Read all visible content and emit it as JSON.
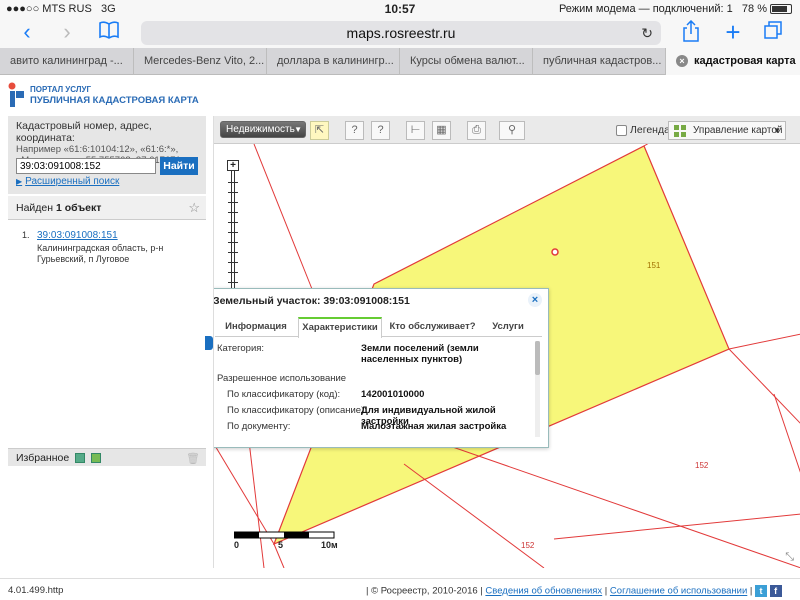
{
  "status_bar": {
    "carrier": "MTS RUS",
    "network": "3G",
    "time": "10:57",
    "hotspot": "Режим модема — подключений: 1",
    "battery": "78 %"
  },
  "browser": {
    "url": "maps.rosreestr.ru",
    "tabs": [
      {
        "label": "авито калининград -..."
      },
      {
        "label": "Mercedes-Benz Vito, 2..."
      },
      {
        "label": "доллара в калинингр..."
      },
      {
        "label": "Курсы обмена валют..."
      },
      {
        "label": "публичная кадастров..."
      },
      {
        "label": "кадастровая карта"
      }
    ]
  },
  "portal": {
    "brand_small": "ПОРТАЛ УСЛУГ",
    "brand_title": "ПУБЛИЧНАЯ КАДАСТРОВАЯ КАРТА"
  },
  "search": {
    "label": "Кадастровый номер, адрес, координата:",
    "hint_line1": "Например «61:6:10104:12», «61:6:*»,",
    "hint_line2": "«Москва» или «55.755768, 37.617671»",
    "value": "39:03:091008:152",
    "button": "Найти",
    "advanced": "Расширенный поиск"
  },
  "results": {
    "found_prefix": "Найден",
    "found_count": "1 объект",
    "items": [
      {
        "num": "1.",
        "cadastral": "39:03:091008:151",
        "address": "Калининградская область, р-н Гурьевский, п Луговое"
      }
    ]
  },
  "favorites": {
    "label": "Избранное"
  },
  "map_toolbar": {
    "layer_dropdown": "Недвижимость",
    "legend_label": "Легенда",
    "map_control": "Управление картой"
  },
  "popup": {
    "title": "Земельный участок: 39:03:091008:151",
    "tabs": [
      "Информация",
      "Характеристики",
      "Кто обслуживает?",
      "Услуги"
    ],
    "rows": {
      "category_label": "Категория:",
      "category_value": "Земли поселений (земли населенных пунктов)",
      "allowed_use": "Разрешенное использование",
      "code_label": "По классификатору (код):",
      "code_value": "142001010000",
      "desc_label": "По классификатору (описание):",
      "desc_value": "Для индивидуальной жилой застройки",
      "doc_label": "По документу:",
      "doc_value": "Малоэтажная жилая застройка"
    }
  },
  "map": {
    "parcel_label_151": "151",
    "parcel_label_152a": "152",
    "parcel_label_152b": "152",
    "scale_0": "0",
    "scale_5": "5",
    "scale_10": "10м",
    "colors": {
      "parcel_fill": "#f7f77a",
      "parcel_border": "#e23a3a"
    }
  },
  "footer": {
    "version": "4.01.499.http",
    "copyright": "| © Росреестр, 2010-2016 |",
    "updates": "Сведения об обновлениях",
    "agreement": "Соглашение об использовании"
  }
}
